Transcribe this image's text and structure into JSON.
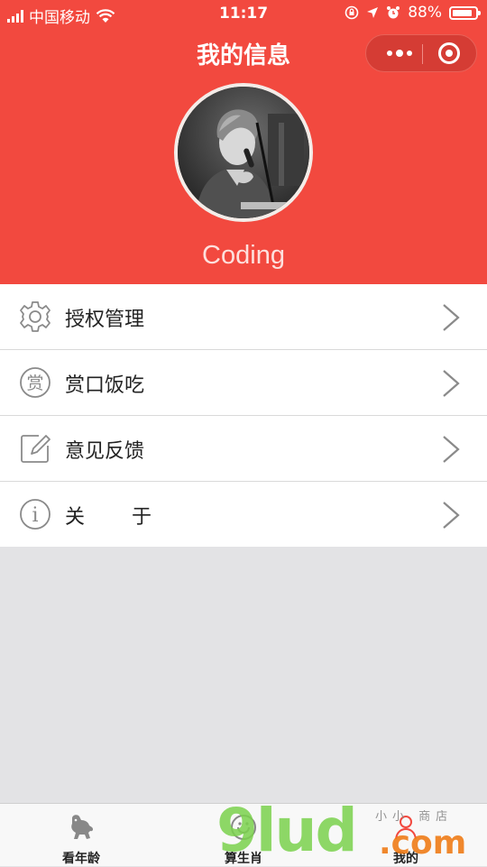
{
  "status_bar": {
    "carrier": "中国移动",
    "time": "11:17",
    "battery": "88%",
    "battery_level": 0.88,
    "icons": [
      "signal-icon",
      "wifi-icon",
      "orientation-lock-icon",
      "location-icon",
      "alarm-icon",
      "battery-icon"
    ]
  },
  "header": {
    "title": "我的信息",
    "capsule_icons": [
      "more-icon",
      "close-target-icon"
    ],
    "username": "Coding",
    "background_color": "#f2493f"
  },
  "menu": {
    "items": [
      {
        "label": "授权管理",
        "icon": "gear-icon"
      },
      {
        "label": "赏口饭吃",
        "icon": "reward-icon",
        "icon_text": "赏"
      },
      {
        "label": "意见反馈",
        "icon": "edit-icon"
      },
      {
        "label": "关于",
        "icon": "info-icon",
        "icon_text": "i"
      }
    ]
  },
  "tabbar": {
    "tabs": [
      {
        "label": "看年龄",
        "icon": "dog-icon"
      },
      {
        "label": "算生肖",
        "icon": "zodiac-icon"
      },
      {
        "label": "我的",
        "icon": "profile-icon"
      }
    ]
  },
  "watermark": {
    "main": "9lud",
    "suffix": ".com",
    "small": "小小 商店"
  }
}
